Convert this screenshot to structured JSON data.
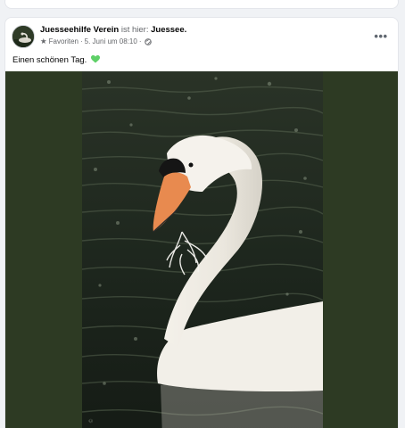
{
  "post": {
    "author": "Juesseehilfe Verein",
    "location_connector": "ist hier:",
    "location": "Juessee.",
    "audience_label": "Favoriten",
    "separator": "·",
    "timestamp": "5. Juni um 08:10",
    "text": "Einen schönen Tag.",
    "more_icon_glyph": "•••",
    "star_icon_glyph": "★"
  },
  "colors": {
    "background": "#f0f2f5",
    "card": "#ffffff",
    "text_primary": "#050505",
    "text_secondary": "#65676b",
    "media_frame": "#2d3a23",
    "heart": "#5fd068"
  },
  "icons": [
    "star-icon",
    "globe-icon",
    "green-heart-emoji",
    "more-options-icon"
  ]
}
